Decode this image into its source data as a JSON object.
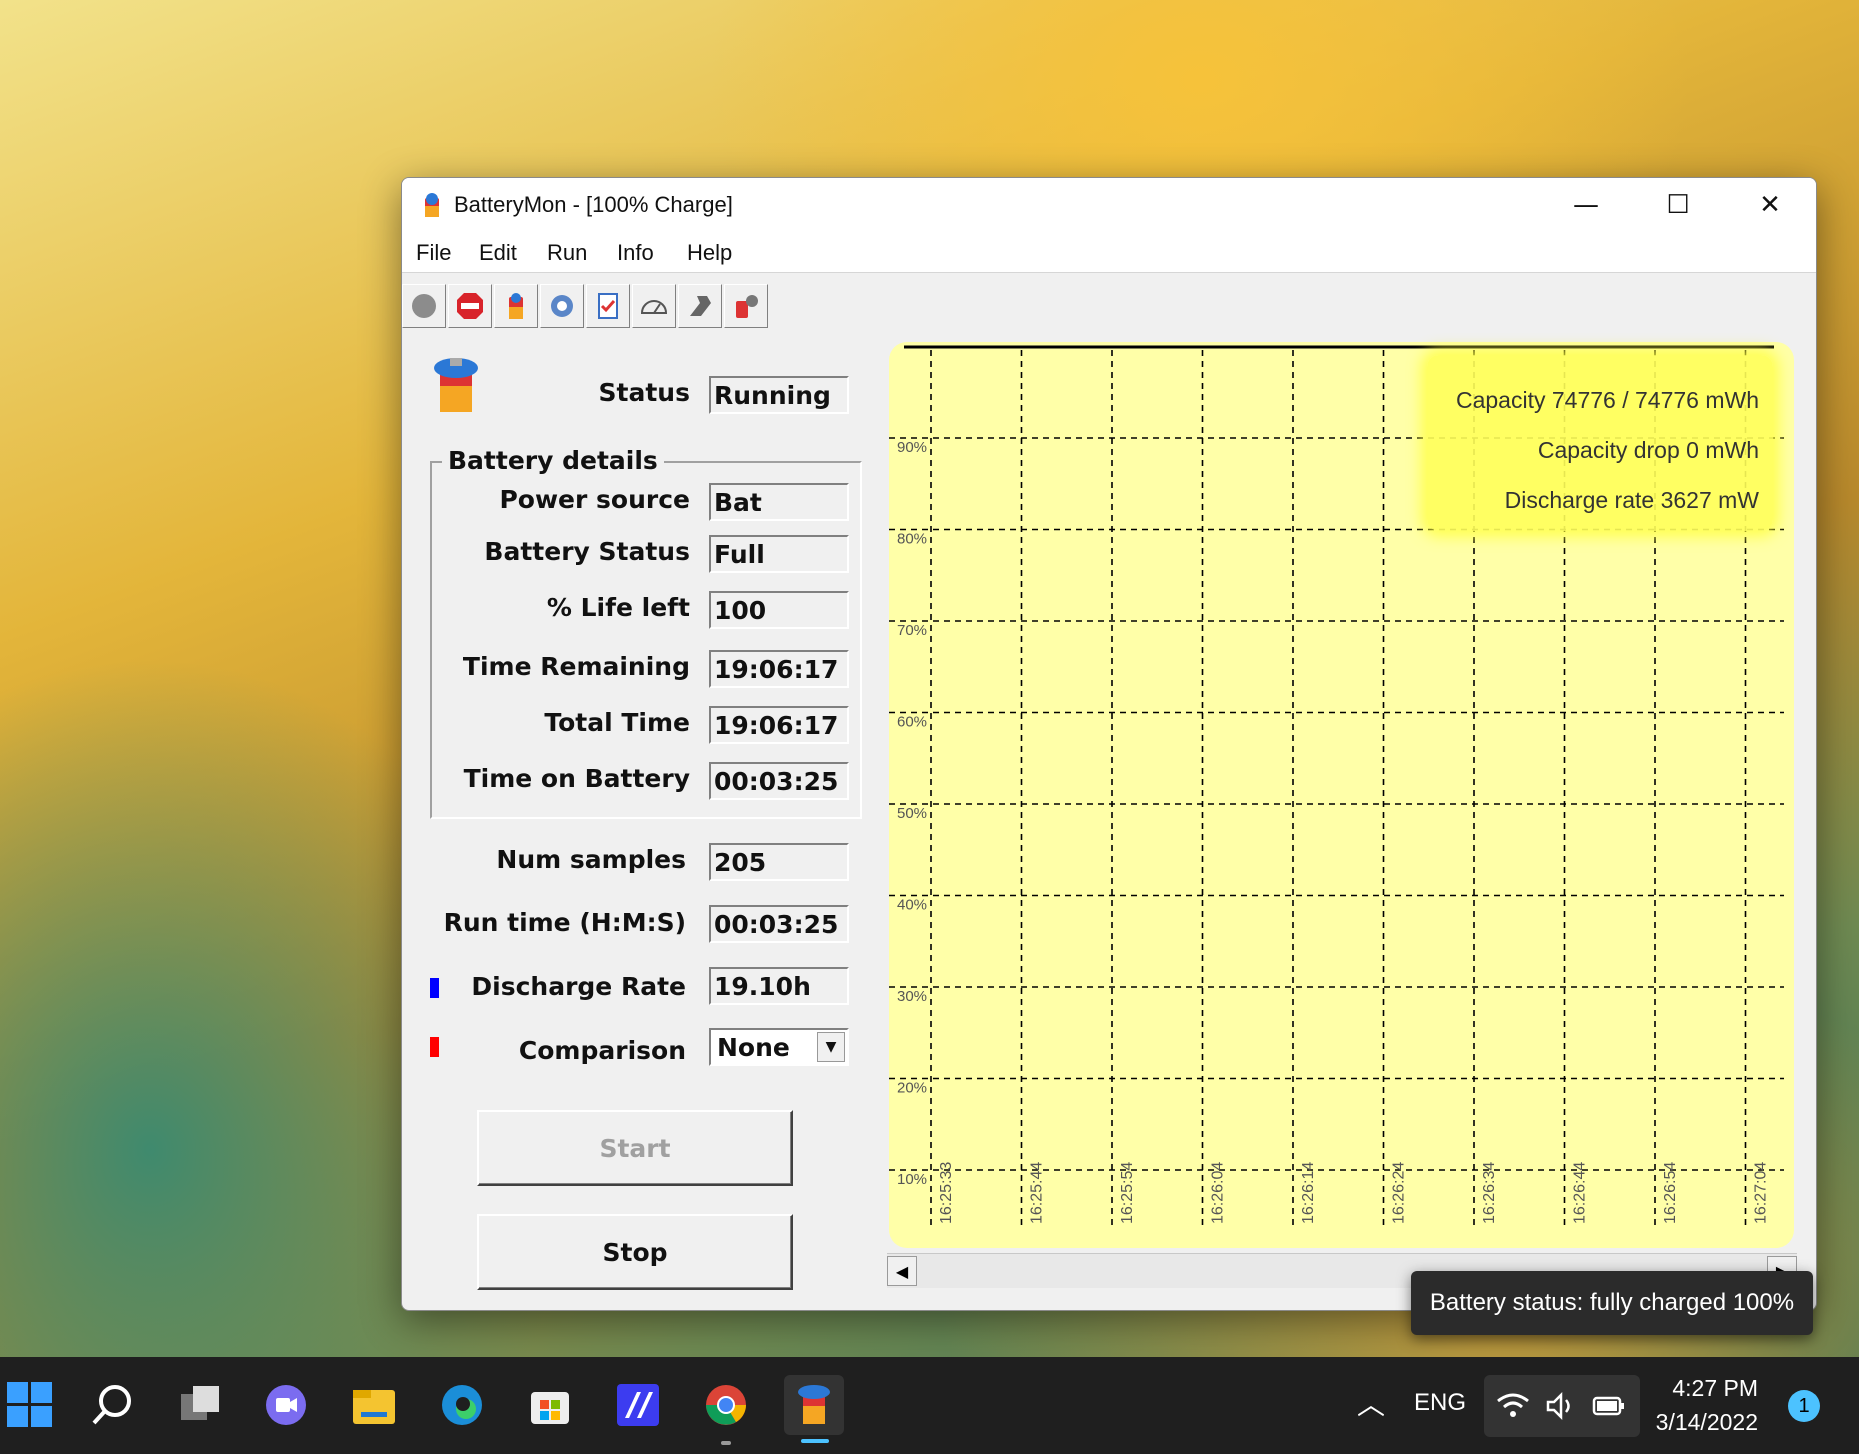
{
  "window": {
    "title": "BatteryMon - [100% Charge]",
    "minimize_glyph": "—",
    "maximize_glyph": "☐",
    "close_glyph": "✕"
  },
  "menu": [
    "File",
    "Edit",
    "Run",
    "Info",
    "Help"
  ],
  "toolbar": [
    "record-icon",
    "stop-icon",
    "battery-icon",
    "settings-icon",
    "checklist-icon",
    "gauge-icon",
    "tools-icon",
    "battery-settings-icon"
  ],
  "status": {
    "label": "Status",
    "value": "Running"
  },
  "battery_details": {
    "title": "Battery details",
    "rows": [
      {
        "label": "Power source",
        "value": "Bat"
      },
      {
        "label": "Battery Status",
        "value": "Full"
      },
      {
        "label": "% Life left",
        "value": "100"
      },
      {
        "label": "Time Remaining",
        "value": "19:06:17"
      },
      {
        "label": "Total Time",
        "value": "19:06:17"
      },
      {
        "label": "Time on Battery",
        "value": "00:03:25"
      }
    ]
  },
  "stats": {
    "num_samples": {
      "label": "Num samples",
      "value": "205"
    },
    "run_time": {
      "label": "Run time (H:M:S)",
      "value": "00:03:25"
    },
    "discharge_rate": {
      "label": "Discharge Rate",
      "value": "19.10h",
      "marker_color": "#0000ff"
    },
    "comparison": {
      "label": "Comparison",
      "value": "None",
      "marker_color": "#ff0000"
    }
  },
  "buttons": {
    "start": "Start",
    "stop": "Stop"
  },
  "chart_data": {
    "type": "line",
    "y_ticks": [
      "90%",
      "80%",
      "70%",
      "60%",
      "50%",
      "40%",
      "30%",
      "20%",
      "10%"
    ],
    "x_ticks": [
      "16:25:33",
      "16:25:44",
      "16:25:54",
      "16:26:04",
      "16:26:14",
      "16:26:24",
      "16:26:34",
      "16:26:44",
      "16:26:54",
      "16:27:04"
    ],
    "ylim": [
      0,
      100
    ],
    "grid": true,
    "info_box": [
      "Capacity 74776 / 74776 mWh",
      "Capacity drop 0 mWh",
      "Discharge rate 3627 mW"
    ],
    "background_color": "#ffffa8",
    "series": [
      {
        "values": [
          100,
          100
        ]
      }
    ]
  },
  "tooltip": "Battery status: fully charged 100%",
  "taskbar": {
    "apps": [
      "windows-start-icon",
      "search-icon",
      "task-view-icon",
      "chat-icon",
      "file-explorer-icon",
      "edge-icon",
      "store-icon",
      "app-icon",
      "chrome-icon",
      "batterymon-icon"
    ],
    "tray": {
      "lang": "ENG",
      "time": "4:27 PM",
      "date": "3/14/2022",
      "notification_count": "1"
    }
  }
}
